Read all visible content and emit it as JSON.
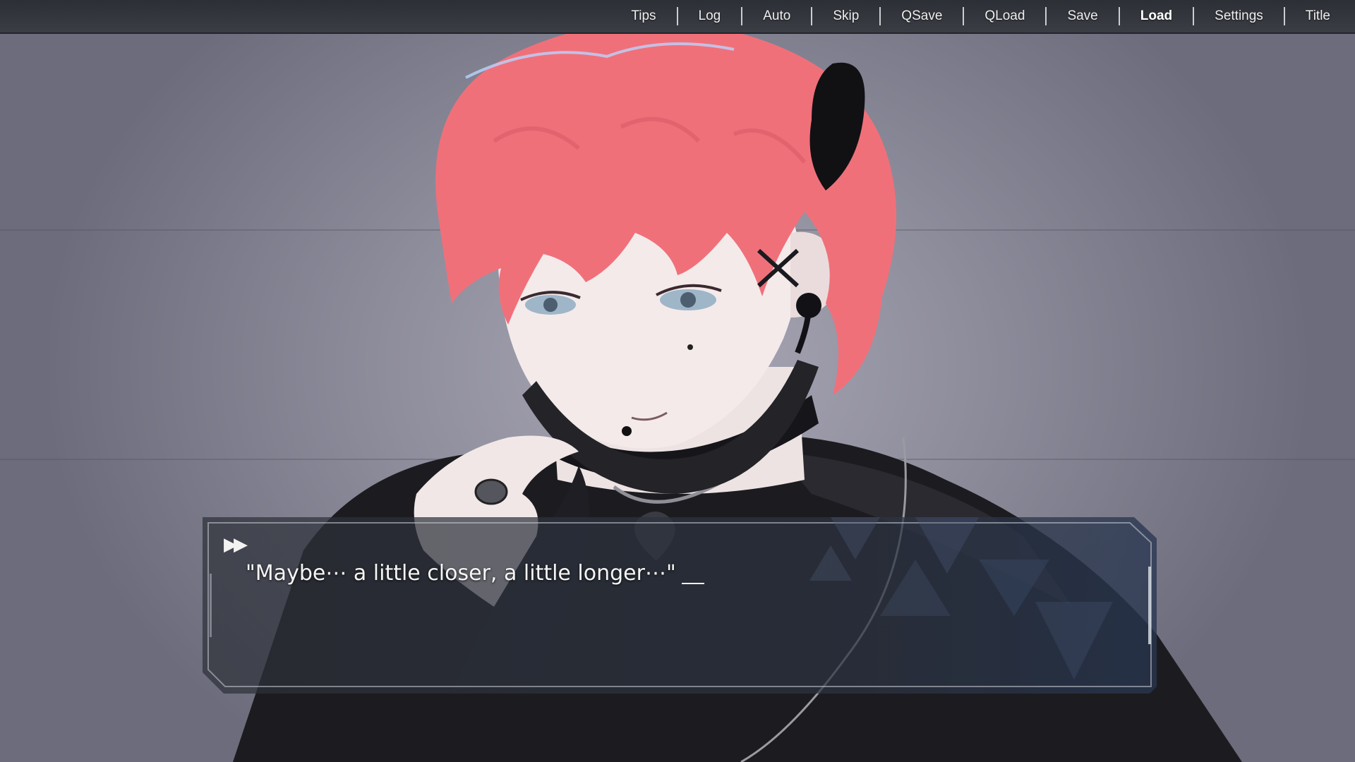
{
  "menu": {
    "items": [
      {
        "label": "Tips"
      },
      {
        "label": "Log"
      },
      {
        "label": "Auto"
      },
      {
        "label": "Skip"
      },
      {
        "label": "QSave"
      },
      {
        "label": "QLoad"
      },
      {
        "label": "Save"
      },
      {
        "label": "Load",
        "active": true
      },
      {
        "label": "Settings"
      },
      {
        "label": "Title"
      }
    ]
  },
  "dialogue": {
    "text": "\"Maybe⋯ a little closer, a little longer⋯\"",
    "skip_indicator": "▶▶"
  },
  "colors": {
    "hair": "#f0707a",
    "menu_bar": "#33353c",
    "dialogue_panel": "#2e3340"
  }
}
